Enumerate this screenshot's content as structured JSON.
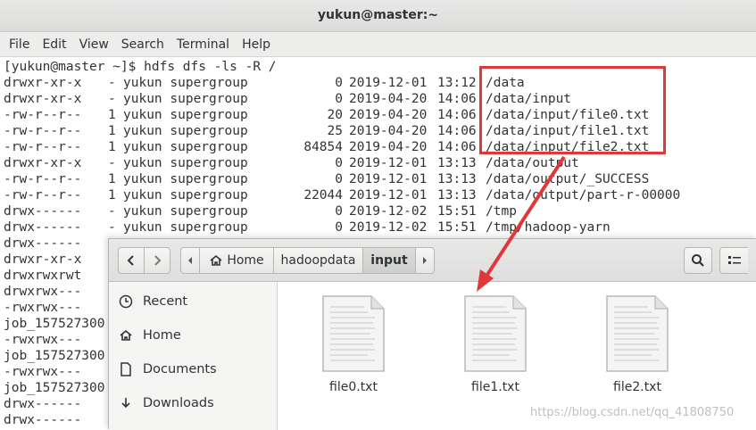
{
  "window": {
    "title": "yukun@master:~"
  },
  "menubar": [
    "File",
    "Edit",
    "View",
    "Search",
    "Terminal",
    "Help"
  ],
  "terminal": {
    "prompt": "[yukun@master ~]$ hdfs dfs -ls -R /",
    "rows": [
      {
        "perm": "drwxr-xr-x",
        "rep": "-",
        "owner": "yukun supergroup",
        "size": "0",
        "date": "2019-12-01",
        "time": "13:12",
        "path": "/data"
      },
      {
        "perm": "drwxr-xr-x",
        "rep": "-",
        "owner": "yukun supergroup",
        "size": "0",
        "date": "2019-04-20",
        "time": "14:06",
        "path": "/data/input"
      },
      {
        "perm": "-rw-r--r--",
        "rep": "1",
        "owner": "yukun supergroup",
        "size": "20",
        "date": "2019-04-20",
        "time": "14:06",
        "path": "/data/input/file0.txt"
      },
      {
        "perm": "-rw-r--r--",
        "rep": "1",
        "owner": "yukun supergroup",
        "size": "25",
        "date": "2019-04-20",
        "time": "14:06",
        "path": "/data/input/file1.txt"
      },
      {
        "perm": "-rw-r--r--",
        "rep": "1",
        "owner": "yukun supergroup",
        "size": "84854",
        "date": "2019-04-20",
        "time": "14:06",
        "path": "/data/input/file2.txt"
      },
      {
        "perm": "drwxr-xr-x",
        "rep": "-",
        "owner": "yukun supergroup",
        "size": "0",
        "date": "2019-12-01",
        "time": "13:13",
        "path": "/data/output"
      },
      {
        "perm": "-rw-r--r--",
        "rep": "1",
        "owner": "yukun supergroup",
        "size": "0",
        "date": "2019-12-01",
        "time": "13:13",
        "path": "/data/output/_SUCCESS"
      },
      {
        "perm": "-rw-r--r--",
        "rep": "1",
        "owner": "yukun supergroup",
        "size": "22044",
        "date": "2019-12-01",
        "time": "13:13",
        "path": "/data/output/part-r-00000"
      },
      {
        "perm": "drwx------",
        "rep": "-",
        "owner": "yukun supergroup",
        "size": "0",
        "date": "2019-12-02",
        "time": "15:51",
        "path": "/tmp"
      },
      {
        "perm": "drwx------",
        "rep": "-",
        "owner": "yukun supergroup",
        "size": "0",
        "date": "2019-12-02",
        "time": "15:51",
        "path": "/tmp/hadoop-yarn"
      }
    ],
    "hidden_rows": [
      "drwx------",
      "drwxr-xr-x",
      "drwxrwxrwt",
      "drwxrwx---",
      "-rwxrwx---",
      "job_157527300",
      "-rwxrwx---",
      "job_157527300",
      "-rwxrwx---",
      "job_157527300",
      "drwx------",
      "drwx------"
    ]
  },
  "file_manager": {
    "breadcrumbs": [
      "Home",
      "hadoopdata",
      "input"
    ],
    "sidebar": [
      {
        "label": "Recent",
        "icon": "clock-icon"
      },
      {
        "label": "Home",
        "icon": "home-icon"
      },
      {
        "label": "Documents",
        "icon": "document-icon"
      },
      {
        "label": "Downloads",
        "icon": "download-icon"
      }
    ],
    "files": [
      "file0.txt",
      "file1.txt",
      "file2.txt"
    ]
  },
  "annotation": {
    "color": "#e0383a"
  },
  "watermark": "https://blog.csdn.net/qq_41808750"
}
